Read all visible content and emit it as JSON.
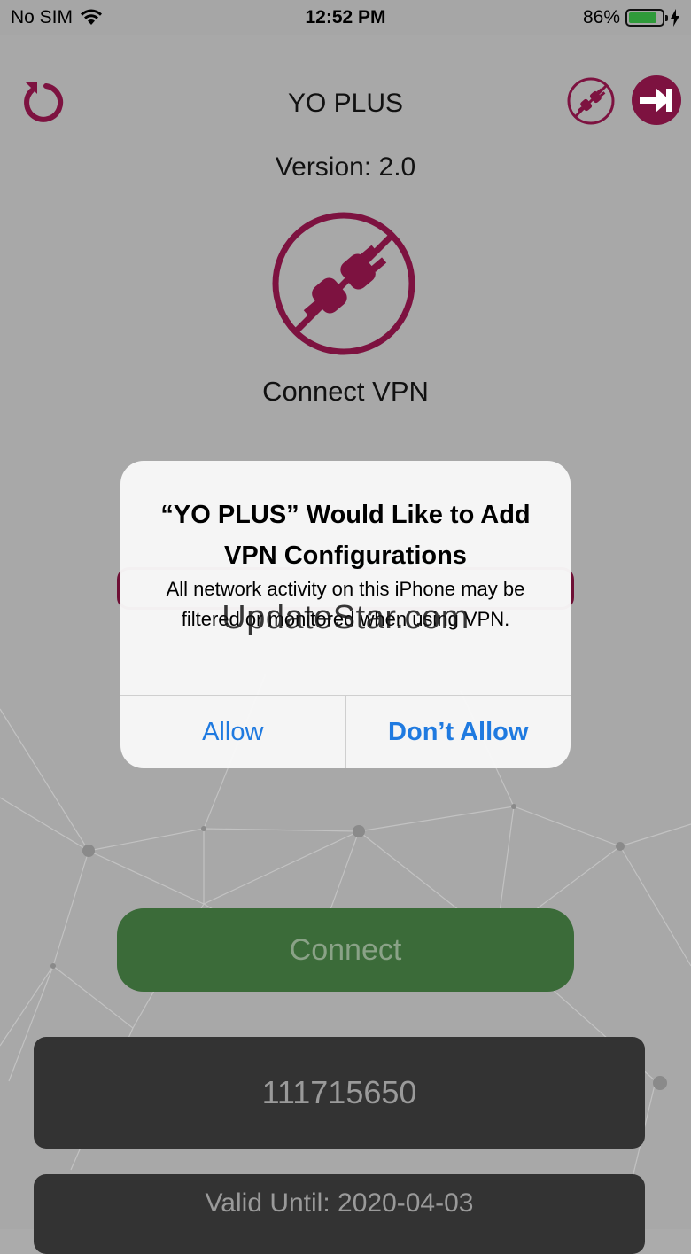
{
  "status_bar": {
    "carrier": "No SIM",
    "time": "12:52 PM",
    "battery_percent": "86%",
    "battery_level": 0.86
  },
  "app": {
    "title": "YO PLUS",
    "version": "Version: 2.0",
    "connect_vpn_label": "Connect VPN",
    "connect_button": "Connect",
    "user_id": "111715650",
    "valid_until": "Valid Until: 2020-04-03",
    "accent_color": "#7d1240"
  },
  "alert": {
    "title": "“YO PLUS” Would Like to Add VPN Configurations",
    "message": "All network activity on this iPhone may be filtered or monitored when using VPN.",
    "allow_label": "Allow",
    "dont_allow_label": "Don’t Allow"
  },
  "watermark": "UpdateStar.com",
  "icons": [
    "wifi-icon",
    "battery-icon",
    "charging-icon",
    "refresh-icon",
    "plug-off-icon",
    "logout-icon"
  ]
}
